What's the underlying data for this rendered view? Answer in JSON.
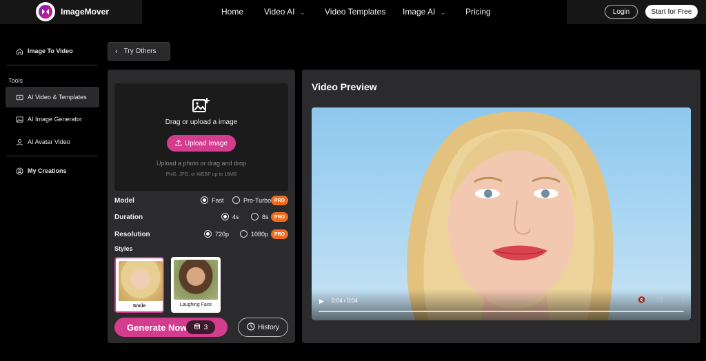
{
  "brand": {
    "name": "ImageMover"
  },
  "nav": {
    "items": [
      {
        "label": "Home"
      },
      {
        "label": "Video AI"
      },
      {
        "label": "Video Templates"
      },
      {
        "label": "Image AI"
      },
      {
        "label": "Pricing"
      }
    ],
    "login": "Login",
    "start": "Start for Free"
  },
  "sidebar": {
    "top_item": "Image To Video",
    "tools_label": "Tools",
    "tools": [
      {
        "label": "AI Video & Templates",
        "icon": "video-icon"
      },
      {
        "label": "AI Image Generator",
        "icon": "image-icon"
      },
      {
        "label": "AI Avatar Video",
        "icon": "avatar-icon"
      }
    ],
    "creations": "My Creations"
  },
  "try_others": "Try Others",
  "upload": {
    "title": "Drag or upload a image",
    "button": "Upload Image",
    "hint": "Upload a photo or drag and drop",
    "formats": "PNG, JPG, or WEBP up to 16MB"
  },
  "options": {
    "model": {
      "label": "Model",
      "choices": [
        "Fast",
        "Pro-Turbo"
      ],
      "selected": "Fast"
    },
    "duration": {
      "label": "Duration",
      "choices": [
        "4s",
        "8s"
      ],
      "selected": "4s"
    },
    "resolution": {
      "label": "Resolution",
      "choices": [
        "720p",
        "1080p"
      ],
      "selected": "720p"
    },
    "pro_badge": "PRO"
  },
  "styles": {
    "label": "Styles",
    "items": [
      {
        "name": "Smile",
        "selected": true
      },
      {
        "name": "Laughing Face",
        "selected": false
      }
    ]
  },
  "generate": {
    "label": "Generate Now",
    "credits": "3"
  },
  "history": "History",
  "preview": {
    "title": "Video Preview",
    "timecode": "0:04 / 0:04",
    "progress": 1.0
  },
  "colors": {
    "accent": "#d43c8d",
    "pro": "#f26b1d",
    "panel": "#2b2b2d"
  }
}
